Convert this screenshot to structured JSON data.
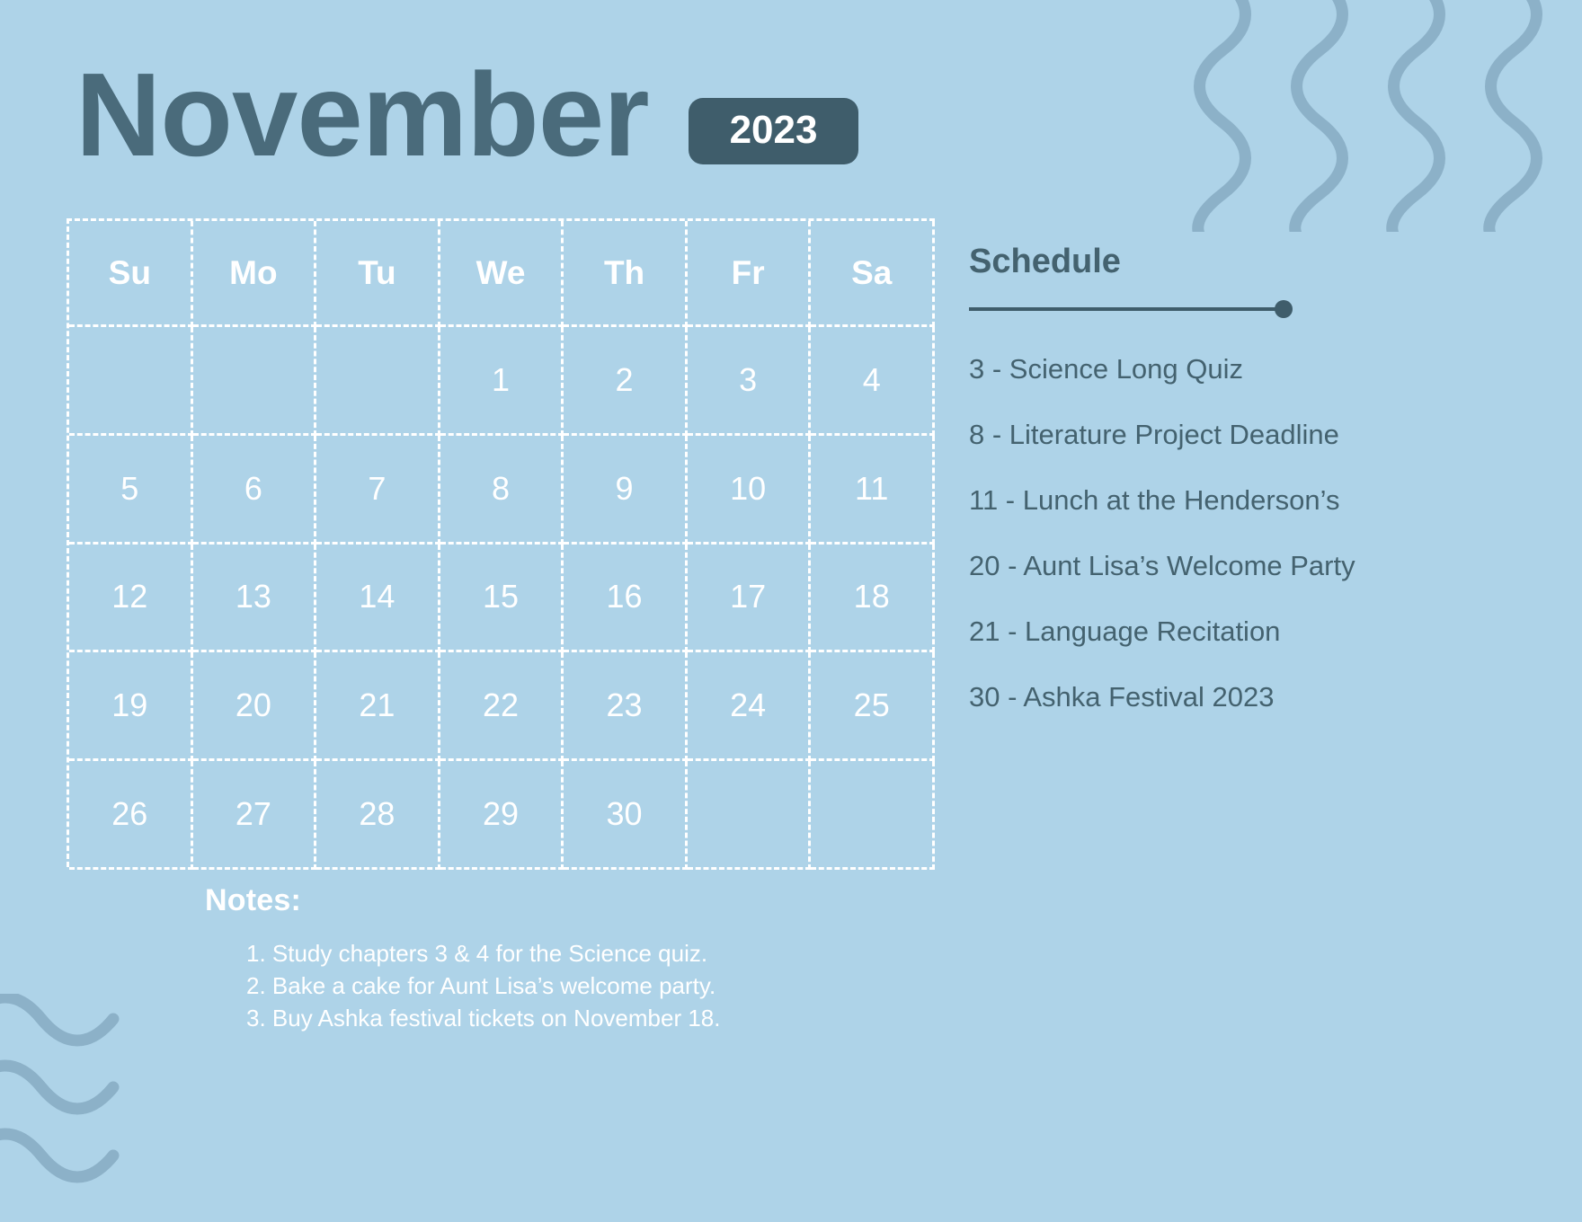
{
  "theme": {
    "background": "#aed3e8",
    "dark_slate": "#3f5d6b",
    "title_color": "#4a6b7b",
    "wave_color": "#8cb1c8",
    "grid_line": "#ffffff"
  },
  "header": {
    "month": "November",
    "year": "2023"
  },
  "calendar": {
    "weekdays": [
      "Su",
      "Mo",
      "Tu",
      "We",
      "Th",
      "Fr",
      "Sa"
    ],
    "weeks": [
      [
        "",
        "",
        "",
        "1",
        "2",
        "3",
        "4"
      ],
      [
        "5",
        "6",
        "7",
        "8",
        "9",
        "10",
        "11"
      ],
      [
        "12",
        "13",
        "14",
        "15",
        "16",
        "17",
        "18"
      ],
      [
        "19",
        "20",
        "21",
        "22",
        "23",
        "24",
        "25"
      ],
      [
        "26",
        "27",
        "28",
        "29",
        "30",
        "",
        ""
      ]
    ]
  },
  "schedule": {
    "title": "Schedule",
    "items": [
      "3 - Science Long Quiz",
      "8 - Literature Project Deadline",
      "11 - Lunch at the Henderson’s",
      "20 - Aunt Lisa’s Welcome Party",
      "21 - Language Recitation",
      "30 - Ashka Festival 2023"
    ]
  },
  "notes": {
    "title": "Notes:",
    "lines": [
      "1. Study chapters 3 & 4 for the Science quiz.",
      "2. Bake a cake for Aunt Lisa’s welcome party.",
      "3. Buy Ashka festival tickets on November 18."
    ]
  }
}
